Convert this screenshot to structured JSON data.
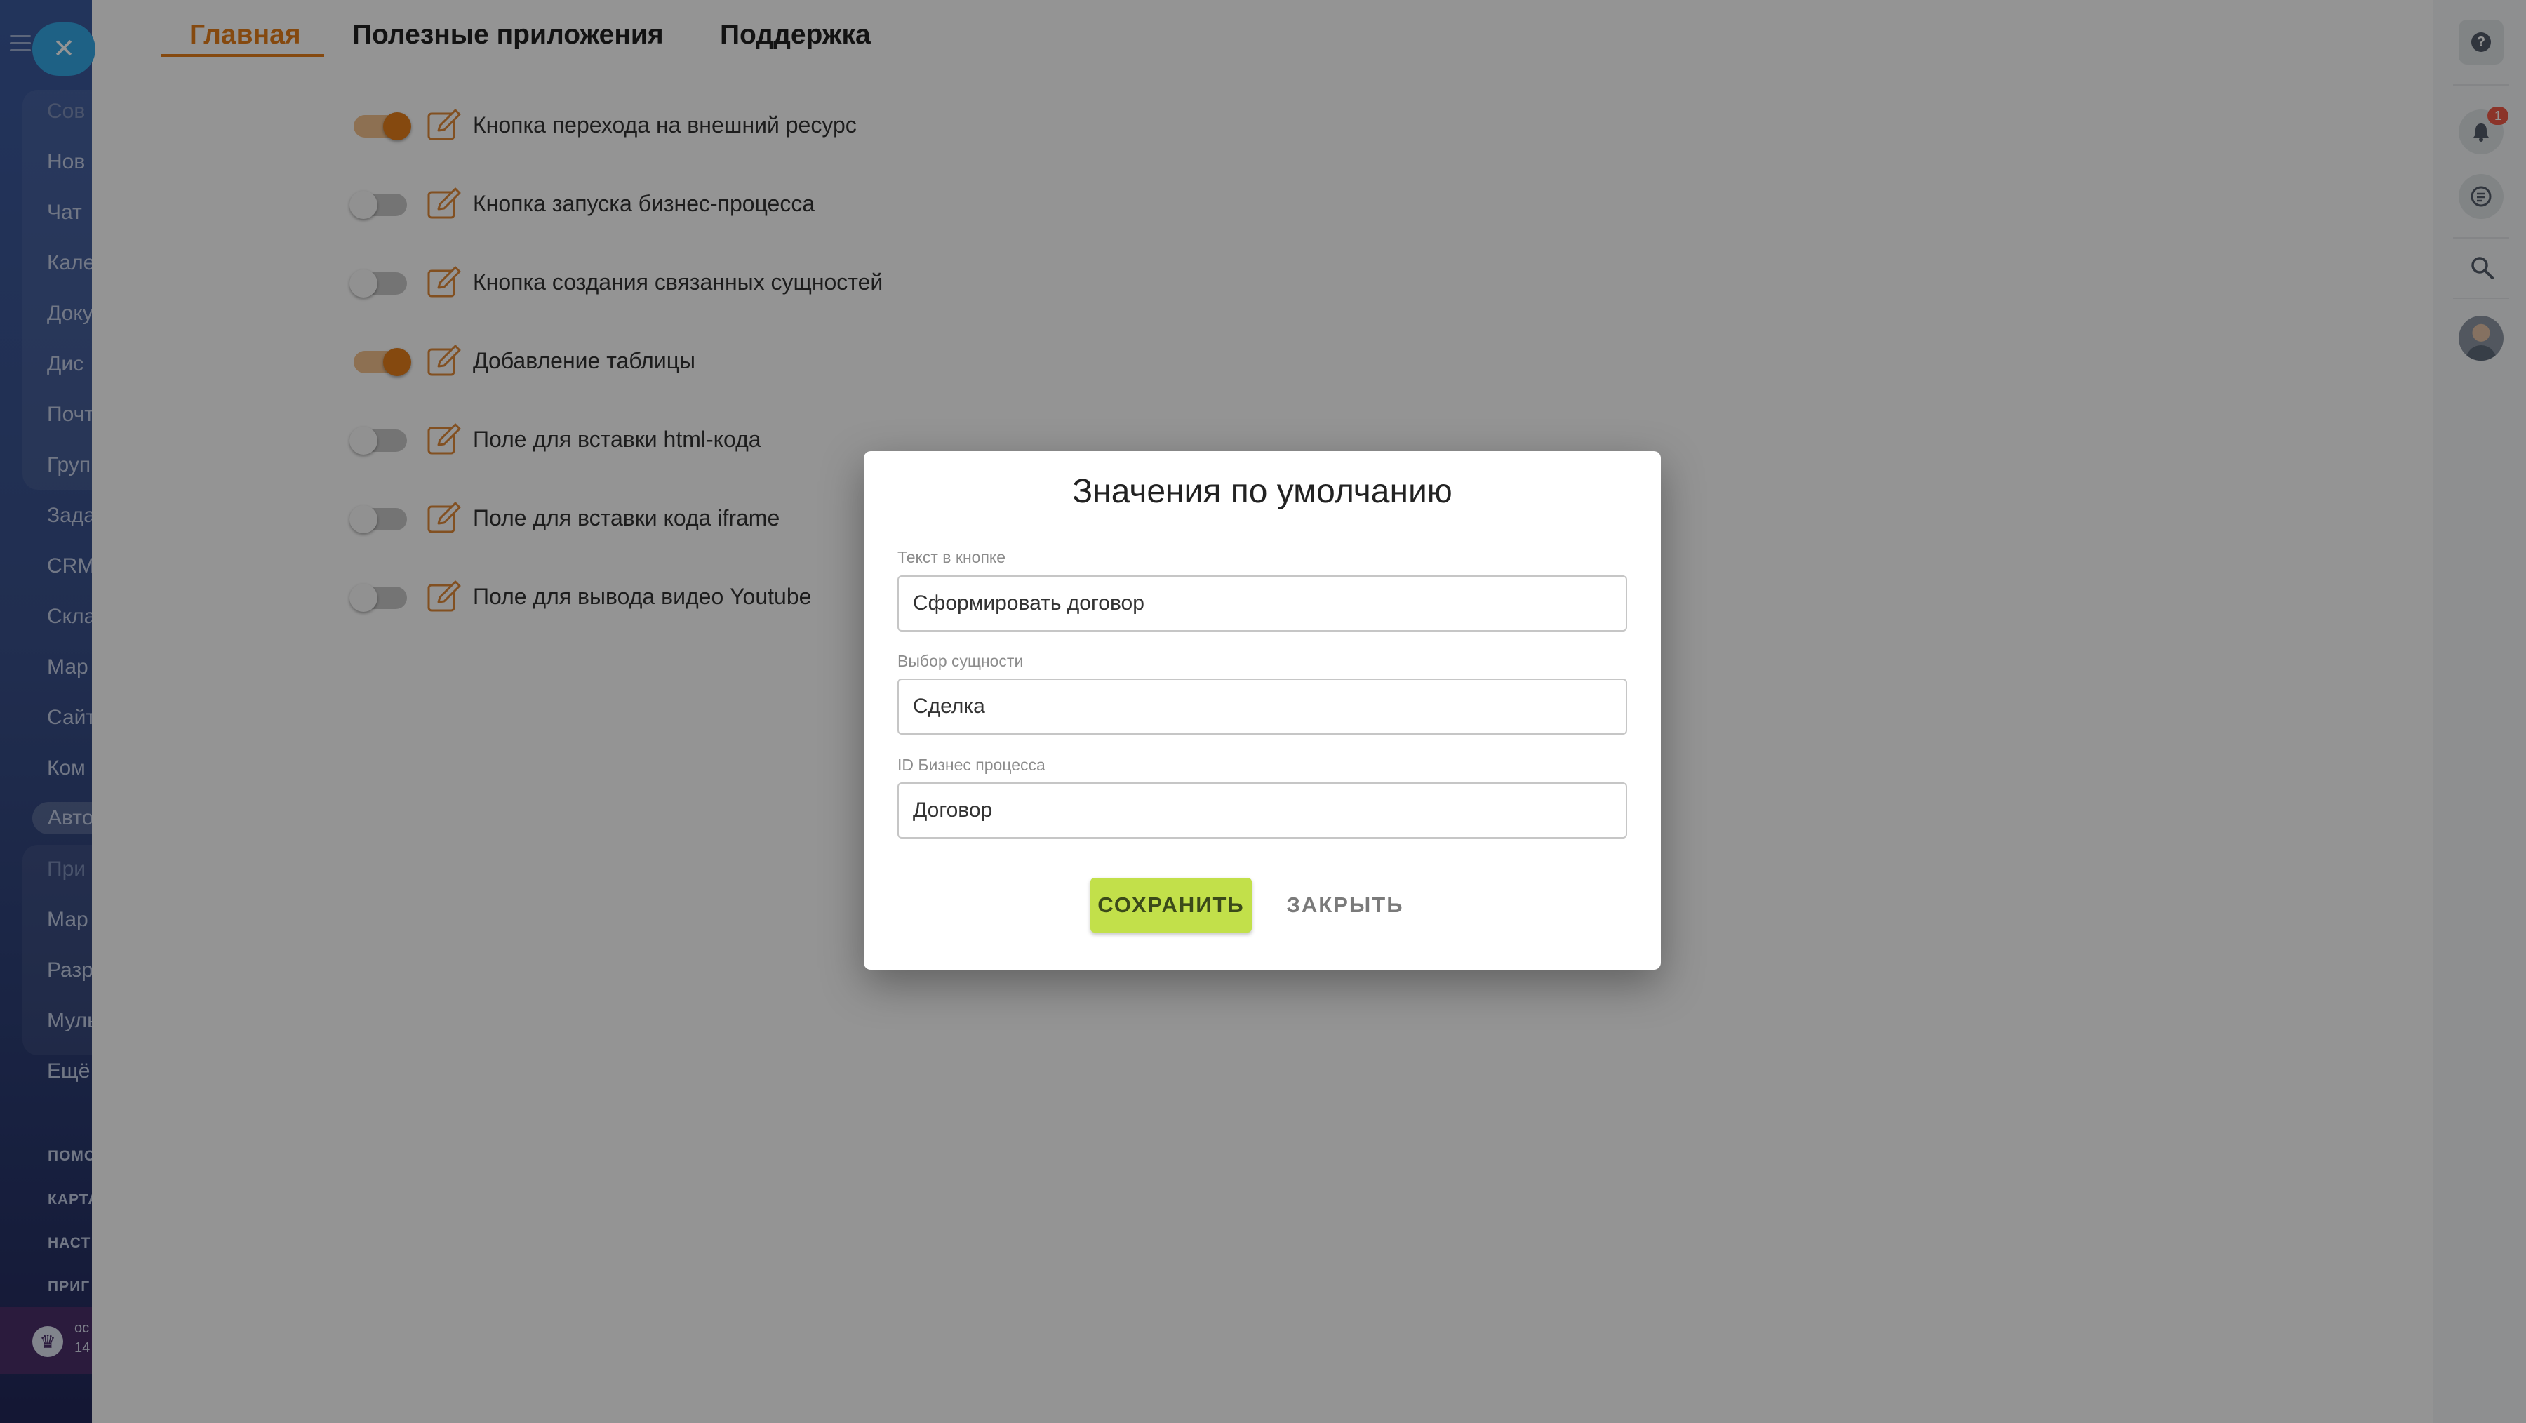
{
  "left_nav": {
    "items_top": [
      "Сов",
      "Нов",
      "Чат",
      "Кале",
      "Доку",
      "Дис",
      "Почт",
      "Груп"
    ],
    "items_mid": [
      "Зада",
      "CRM",
      "Скла",
      "Мар",
      "Сайт",
      "Ком"
    ],
    "active_item": "Авто",
    "items_apps": [
      "При",
      "Мар",
      "Разр",
      "Муль"
    ],
    "more": "Ещё",
    "small_links": [
      "ПОМО",
      "КАРТА",
      "НАСТ",
      "ПРИГ"
    ],
    "footer_line1": "ос",
    "footer_line2": "14"
  },
  "slider": {
    "close_icon": "close-icon",
    "tabs": [
      {
        "label": "Главная",
        "active": true
      },
      {
        "label": "Полезные приложения",
        "active": false
      },
      {
        "label": "Поддержка",
        "active": false
      }
    ],
    "accent_color": "#e57f1a",
    "settings": [
      {
        "label": "Кнопка перехода на внешний ресурс",
        "enabled": true
      },
      {
        "label": "Кнопка запуска бизнес-процесса",
        "enabled": false
      },
      {
        "label": "Кнопка создания связанных сущностей",
        "enabled": false
      },
      {
        "label": "Добавление таблицы",
        "enabled": true
      },
      {
        "label": "Поле для вставки html-кода",
        "enabled": false
      },
      {
        "label": "Поле для вставки кода iframe",
        "enabled": false
      },
      {
        "label": "Поле для вывода видео Youtube",
        "enabled": false
      }
    ]
  },
  "modal": {
    "title": "Значения по умолчанию",
    "fields": [
      {
        "label": "Текст в кнопке",
        "value": "Сформировать договор"
      },
      {
        "label": "Выбор сущности",
        "value": "Сделка"
      },
      {
        "label": "ID Бизнес процесса",
        "value": "Договор"
      }
    ],
    "save_label": "СОХРАНИТЬ",
    "close_label": "ЗАКРЫТЬ",
    "save_color": "#c2e04a"
  },
  "right_bar": {
    "help_label": "?",
    "notifications_count": "1",
    "icons": [
      "help-icon",
      "bell-icon",
      "chat-icon",
      "search-icon",
      "avatar"
    ]
  }
}
